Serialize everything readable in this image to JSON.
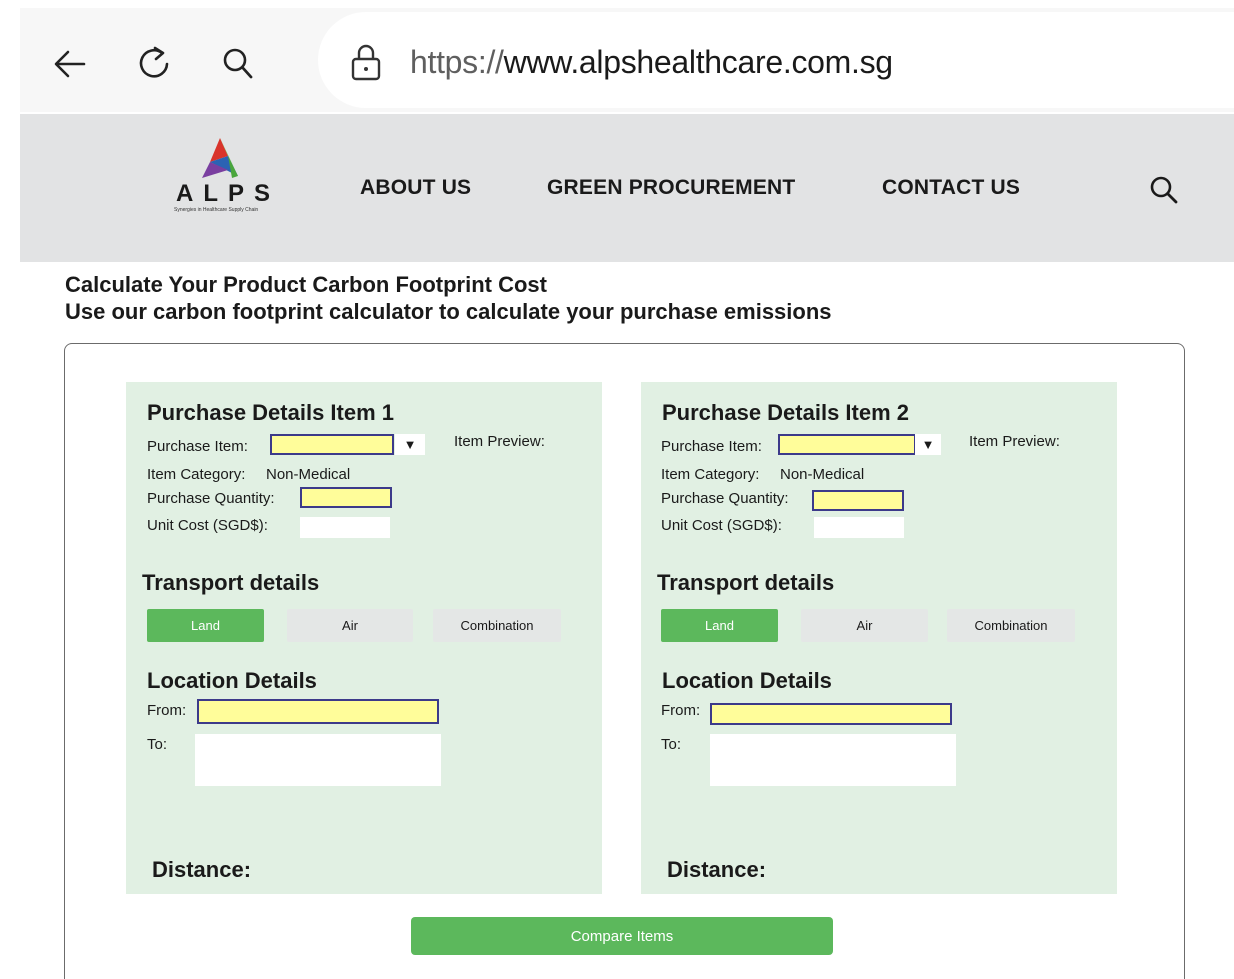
{
  "browser": {
    "back_icon": "arrow-left-icon",
    "refresh_icon": "refresh-icon",
    "search_icon": "search-icon",
    "lock_icon": "lock-icon",
    "url_scheme": "https://",
    "url_host": "www.alpshealthcare.com.sg"
  },
  "header": {
    "logo_text": "ALPS",
    "logo_tagline": "Synergies in Healthcare Supply Chain",
    "nav": [
      "ABOUT US",
      "GREEN PROCUREMENT",
      "CONTACT US"
    ],
    "search_icon": "search-icon"
  },
  "page": {
    "title": "Calculate Your Product Carbon Footprint Cost",
    "subtitle": "Use our carbon footprint calculator to calculate your purchase emissions"
  },
  "panels": [
    {
      "title": "Purchase Details Item 1",
      "purchase_item_label": "Purchase Item:",
      "purchase_item_value": "",
      "item_preview_label": "Item Preview:",
      "item_category_label": "Item Category:",
      "item_category_value": "Non-Medical",
      "quantity_label": "Purchase Quantity:",
      "quantity_value": "",
      "unit_cost_label": "Unit Cost (SGD$):",
      "unit_cost_value": "",
      "transport_title": "Transport details",
      "modes": [
        "Land",
        "Air",
        "Combination"
      ],
      "active_mode": "Land",
      "location_title": "Location Details",
      "from_label": "From:",
      "from_value": "",
      "to_label": "To:",
      "to_value": "",
      "distance_label": "Distance:"
    },
    {
      "title": "Purchase Details Item 2",
      "purchase_item_label": "Purchase Item:",
      "purchase_item_value": "",
      "item_preview_label": "Item Preview:",
      "item_category_label": "Item Category:",
      "item_category_value": "Non-Medical",
      "quantity_label": "Purchase Quantity:",
      "quantity_value": "",
      "unit_cost_label": "Unit Cost (SGD$):",
      "unit_cost_value": "",
      "transport_title": "Transport details",
      "modes": [
        "Land",
        "Air",
        "Combination"
      ],
      "active_mode": "Land",
      "location_title": "Location Details",
      "from_label": "From:",
      "from_value": "",
      "to_label": "To:",
      "to_value": "",
      "distance_label": "Distance:"
    }
  ],
  "compare_button": "Compare Items",
  "colors": {
    "accent_green": "#5cb85c",
    "panel_bg": "#e1f0e3",
    "header_bg": "#e2e3e4",
    "field_yellow": "#fffd9a",
    "field_border": "#3c3a8a"
  }
}
